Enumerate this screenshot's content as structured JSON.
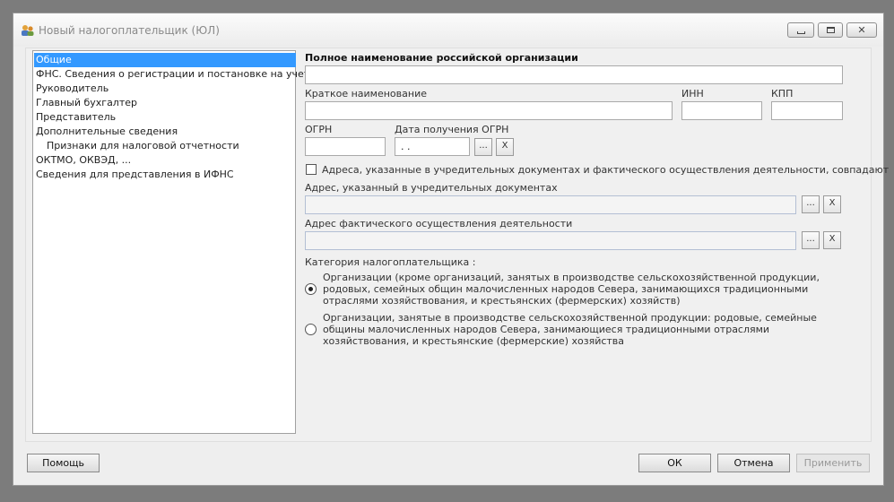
{
  "window": {
    "title": "Новый налогоплательщик (ЮЛ)",
    "controls": {
      "minimize_icon": "minimize-icon",
      "maximize_icon": "maximize-icon",
      "close_icon": "close-icon"
    }
  },
  "nav": {
    "items": [
      {
        "label": "Общие",
        "selected": true
      },
      {
        "label": "ФНС. Сведения о регистрации и постановке на учет"
      },
      {
        "label": "Руководитель"
      },
      {
        "label": "Главный бухгалтер"
      },
      {
        "label": "Представитель"
      },
      {
        "label": "Дополнительные сведения"
      },
      {
        "label": "Признаки для налоговой отчетности"
      },
      {
        "label": "ОКТМО, ОКВЭД, ..."
      },
      {
        "label": "Сведения для представления в ИФНС"
      }
    ]
  },
  "form": {
    "full_name_label": "Полное наименование российской организации",
    "full_name_value": "",
    "short_name_label": "Краткое наименование",
    "short_name_value": "",
    "inn_label": "ИНН",
    "inn_value": "",
    "kpp_label": "КПП",
    "kpp_value": "",
    "ogrn_label": "ОГРН",
    "ogrn_value": "",
    "ogrn_date_label": "Дата получения ОГРН",
    "ogrn_date_value": " .  .",
    "browse_label": "...",
    "clear_label": "X",
    "same_address_label": "Адреса, указанные в учредительных документах и фактического осуществления деятельности, совпадают",
    "same_address_checked": false,
    "legal_address_label": "Адрес, указанный в учредительных документах",
    "legal_address_value": "",
    "actual_address_label": "Адрес фактического осуществления деятельности",
    "actual_address_value": "",
    "category_label": "Категория налогоплательщика :",
    "category_options": [
      {
        "label": "Организации (кроме организаций, занятых в производстве сельскохозяйственной продукции, родовых, семейных общин малочисленных народов Севера, занимающихся традиционными отраслями хозяйствования, и крестьянских (фермерских) хозяйств)",
        "selected": true
      },
      {
        "label": "Организации, занятые в производстве сельскохозяйственной продукции: родовые, семейные общины малочисленных народов Севера, занимающиеся традиционными отраслями хозяйствования, и крестьянские (фермерские) хозяйства",
        "selected": false
      }
    ]
  },
  "footer": {
    "help_label": "Помощь",
    "ok_label": "ОК",
    "cancel_label": "Отмена",
    "apply_label": "Применить"
  }
}
